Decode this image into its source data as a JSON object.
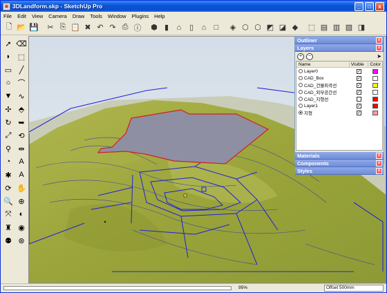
{
  "window": {
    "title": "3DLandform.skp - SketchUp Pro",
    "minimize_glyph": "_",
    "maximize_glyph": "□",
    "close_glyph": "x"
  },
  "menu": [
    "File",
    "Edit",
    "View",
    "Camera",
    "Draw",
    "Tools",
    "Window",
    "Plugins",
    "Help"
  ],
  "toolbar_icons": [
    "new-icon",
    "open-icon",
    "save-icon",
    "cut-icon",
    "copy-icon",
    "paste-icon",
    "erase-icon",
    "undo-icon",
    "redo-icon",
    "print-icon",
    "model-info-icon",
    "iso-view-icon",
    "top-view-icon",
    "front-view-icon",
    "right-view-icon",
    "back-view-icon",
    "left-view-icon",
    "xray-icon",
    "wireframe-icon",
    "hidden-line-icon",
    "shaded-icon",
    "shaded-texture-icon",
    "monochrome-icon",
    "components-icon",
    "materials-icon",
    "warehouse-icon",
    "share-icon",
    "export-icon"
  ],
  "left_tool_icons": [
    "select-icon",
    "eraser-icon",
    "paint-icon",
    "make-component-icon",
    "rectangle-icon",
    "line-icon",
    "circle-icon",
    "arc-icon",
    "polygon-icon",
    "freehand-icon",
    "move-icon",
    "push-pull-icon",
    "rotate-icon",
    "follow-me-icon",
    "scale-icon",
    "offset-icon",
    "tape-icon",
    "dimension-icon",
    "protractor-icon",
    "text-icon",
    "axes-icon",
    "3d-text-icon",
    "orbit-icon",
    "pan-icon",
    "zoom-icon",
    "zoom-window-icon",
    "zoom-extents-icon",
    "previous-view-icon",
    "position-camera-icon",
    "look-around-icon",
    "walk-icon",
    "section-icon"
  ],
  "tray": {
    "outliner": "Outliner",
    "layers": "Layers",
    "materials": "Materials",
    "components": "Components",
    "styles": "Styles",
    "close_glyph": "x",
    "add_glyph": "+",
    "remove_glyph": "−",
    "columns": {
      "name": "Name",
      "visible": "Visible",
      "color": "Color"
    },
    "layer_rows": [
      {
        "name": "Layer0",
        "visible": true,
        "color": "#ff00ff",
        "active": false
      },
      {
        "name": "CAD_Box",
        "visible": true,
        "color": "#ffffff",
        "active": false
      },
      {
        "name": "CAD_건물외곽선",
        "visible": true,
        "color": "#ffff00",
        "active": false
      },
      {
        "name": "CAD_외부공간선",
        "visible": true,
        "color": "#ffffff",
        "active": false
      },
      {
        "name": "CAD_지형선",
        "visible": false,
        "color": "#ff0000",
        "active": false
      },
      {
        "name": "Layer1",
        "visible": true,
        "color": "#ff0000",
        "active": false
      },
      {
        "name": "지형",
        "visible": true,
        "color": "#ff9aa2",
        "active": true
      }
    ]
  },
  "status": {
    "zoom": "95%",
    "offset_label": "Offset",
    "offset_value": "500mm"
  },
  "colors": {
    "terrain": "#9aa63a",
    "building_roof": "#8e8fa3",
    "outline": "#2a2ad8",
    "sky": "#dbe3ea"
  }
}
